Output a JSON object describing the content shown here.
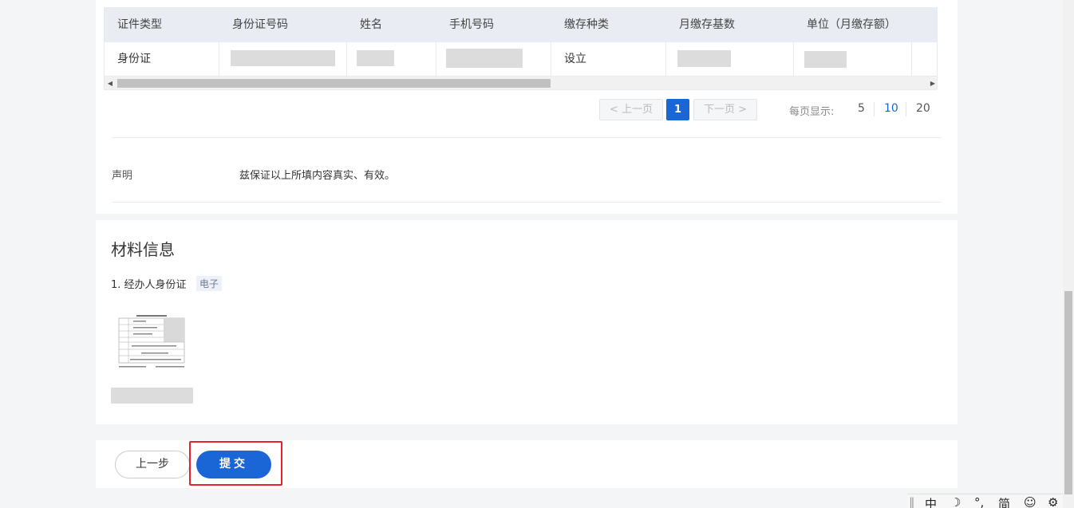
{
  "table": {
    "headers": [
      "证件类型",
      "身份证号码",
      "姓名",
      "手机号码",
      "缴存种类",
      "月缴存基数",
      "单位（月缴存额）"
    ],
    "row": {
      "id_type": "身份证",
      "deposit_type": "设立"
    }
  },
  "pagination": {
    "prev": "< 上一页",
    "current": "1",
    "next": "下一页 >",
    "size_label": "每页显示:",
    "sizes": [
      "5",
      "10",
      "20"
    ],
    "active_size": "10"
  },
  "declaration": {
    "label": "声明",
    "text": "兹保证以上所填内容真实、有效。"
  },
  "materials": {
    "title": "材料信息",
    "items": [
      {
        "name": "1. 经办人身份证",
        "tag": "电子"
      }
    ]
  },
  "actions": {
    "prev_label": "上一步",
    "submit_label": "提交"
  },
  "ime_bar": {
    "items": [
      "中",
      "☽",
      "°,",
      "简",
      "☺",
      "⚙"
    ]
  },
  "colors": {
    "primary": "#1a66d6",
    "highlight": "#e5222a"
  }
}
